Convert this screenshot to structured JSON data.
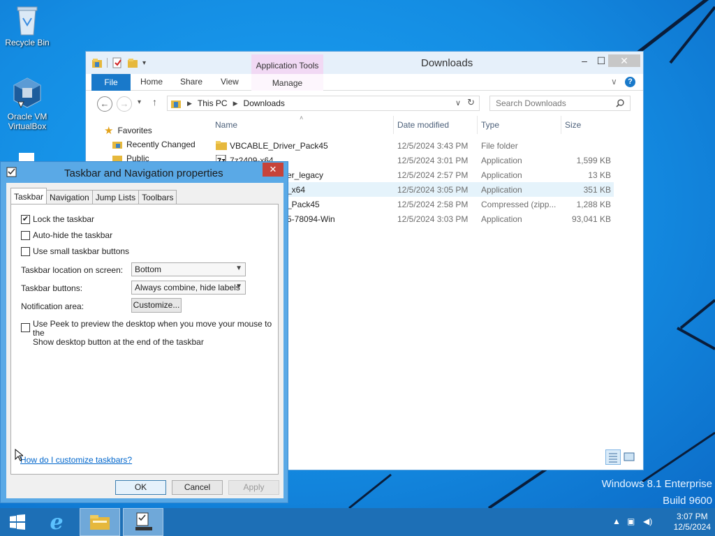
{
  "desktop": {
    "icons": [
      {
        "label": "Recycle Bin",
        "icon": "recycle-bin-icon"
      },
      {
        "label_line1": "Oracle VM",
        "label_line2": "VirtualBox",
        "icon": "virtualbox-icon"
      }
    ],
    "watermark": {
      "line1": "Windows 8.1 Enterprise",
      "line2": "Build 9600"
    }
  },
  "explorer": {
    "title": "Downloads",
    "context_tab": "Application Tools",
    "ribbon_tabs": [
      "File",
      "Home",
      "Share",
      "View",
      "Manage"
    ],
    "breadcrumb": [
      "This PC",
      "Downloads"
    ],
    "search_placeholder": "Search Downloads",
    "nav": {
      "favorites": "Favorites",
      "recent": "Recently Changed",
      "public": "Public"
    },
    "columns": {
      "name": "Name",
      "date": "Date modified",
      "type": "Type",
      "size": "Size"
    },
    "files": [
      {
        "name": "VBCABLE_Driver_Pack45",
        "date": "12/5/2024 3:43 PM",
        "type": "File folder",
        "size": "",
        "icon": "folder-icon"
      },
      {
        "name": "7z2409-x64",
        "date": "12/5/2024 3:01 PM",
        "type": "Application",
        "size": "1,599 KB",
        "icon": "7zip-icon"
      },
      {
        "name": "er_legacy",
        "date": "12/5/2024 2:57 PM",
        "type": "Application",
        "size": "13 KB",
        "icon": ""
      },
      {
        "name": "_x64",
        "date": "12/5/2024 3:05 PM",
        "type": "Application",
        "size": "351 KB",
        "icon": ""
      },
      {
        "name": "_Pack45",
        "date": "12/5/2024 2:58 PM",
        "type": "Compressed (zipp...",
        "size": "1,288 KB",
        "icon": ""
      },
      {
        "name": "5-78094-Win",
        "date": "12/5/2024 3:03 PM",
        "type": "Application",
        "size": "93,041 KB",
        "icon": ""
      }
    ]
  },
  "dialog": {
    "title": "Taskbar and Navigation properties",
    "tabs": [
      "Taskbar",
      "Navigation",
      "Jump Lists",
      "Toolbars"
    ],
    "lock_taskbar": "Lock the taskbar",
    "auto_hide": "Auto-hide the taskbar",
    "small_buttons": "Use small taskbar buttons",
    "location_label": "Taskbar location on screen:",
    "location_value": "Bottom",
    "buttons_label": "Taskbar buttons:",
    "buttons_value": "Always combine, hide labels",
    "notification_label": "Notification area:",
    "customize_button": "Customize...",
    "peek_line1": "Use Peek to preview the desktop when you move your mouse to the",
    "peek_line2": "Show desktop button at the end of the taskbar",
    "help_link": "How do I customize taskbars?",
    "ok": "OK",
    "cancel": "Cancel",
    "apply": "Apply",
    "checks": {
      "lock": true,
      "autohide": false,
      "small": false,
      "peek": false
    }
  },
  "taskbar": {
    "time": "3:07 PM",
    "date": "12/5/2024"
  },
  "colors": {
    "accent": "#1979ca",
    "taskbar": "#1d6fb6",
    "context_tab": "#f1d9f4"
  }
}
